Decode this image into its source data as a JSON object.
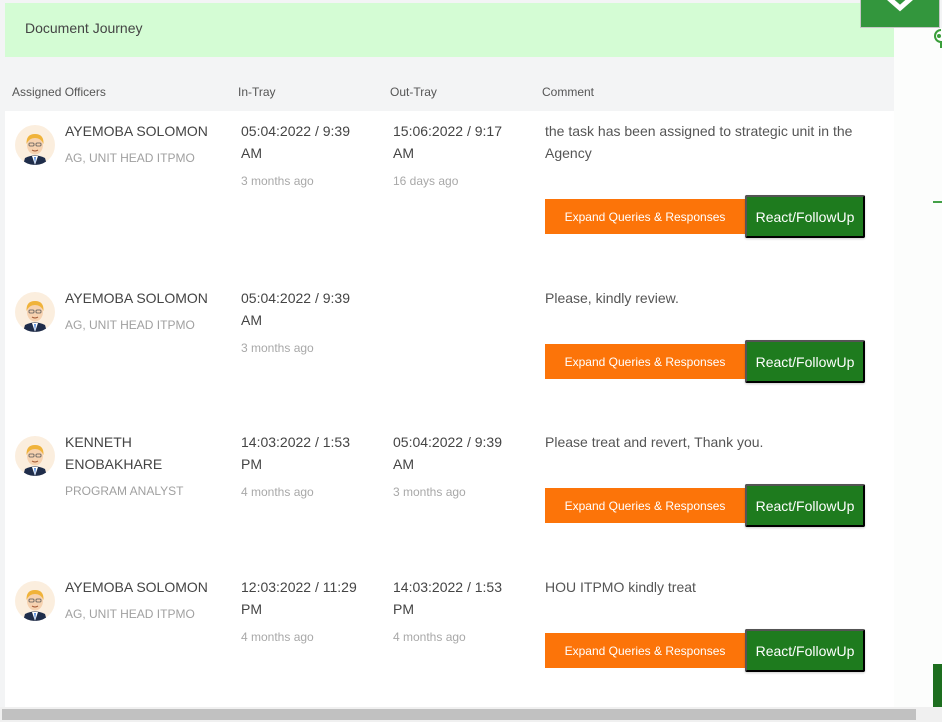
{
  "panel": {
    "title": "Document Journey"
  },
  "columns": {
    "officers": "Assigned Officers",
    "in_tray": "In-Tray",
    "out_tray": "Out-Tray",
    "comment": "Comment"
  },
  "colors": {
    "header_bg": "#d4fcd4",
    "expand_button": "#fc7409",
    "react_button": "#1e7b1e",
    "close_button": "#33963d"
  },
  "icons": {
    "close": "close-icon",
    "avatar": "avatar-icon",
    "pin": "map-pin-icon"
  },
  "rows": [
    {
      "officer_name": "AYEMOBA SOLOMON",
      "officer_role": "AG, UNIT HEAD ITPMO",
      "in_tray_date": "05:04:2022 / 9:39 AM",
      "in_tray_ago": "3 months ago",
      "out_tray_date": "15:06:2022 / 9:17 AM",
      "out_tray_ago": "16 days ago",
      "comment": "the task has been assigned to strategic unit in the Agency",
      "expand_label": "Expand Queries & Responses",
      "react_label": "React/FollowUp"
    },
    {
      "officer_name": "AYEMOBA SOLOMON",
      "officer_role": "AG, UNIT HEAD ITPMO",
      "in_tray_date": "05:04:2022 / 9:39 AM",
      "in_tray_ago": "3 months ago",
      "out_tray_date": "",
      "out_tray_ago": "",
      "comment": "Please, kindly review.",
      "expand_label": "Expand Queries & Responses",
      "react_label": "React/FollowUp"
    },
    {
      "officer_name": "KENNETH ENOBAKHARE",
      "officer_role": "PROGRAM ANALYST",
      "in_tray_date": "14:03:2022 / 1:53 PM",
      "in_tray_ago": "4 months ago",
      "out_tray_date": "05:04:2022 / 9:39 AM",
      "out_tray_ago": "3 months ago",
      "comment": "Please treat and revert, Thank you.",
      "expand_label": "Expand Queries & Responses",
      "react_label": "React/FollowUp"
    },
    {
      "officer_name": "AYEMOBA SOLOMON",
      "officer_role": "AG, UNIT HEAD ITPMO",
      "in_tray_date": "12:03:2022 / 11:29 PM",
      "in_tray_ago": "4 months ago",
      "out_tray_date": "14:03:2022 / 1:53 PM",
      "out_tray_ago": "4 months ago",
      "comment": "HOU ITPMO kindly treat",
      "expand_label": "Expand Queries & Responses",
      "react_label": "React/FollowUp"
    }
  ]
}
